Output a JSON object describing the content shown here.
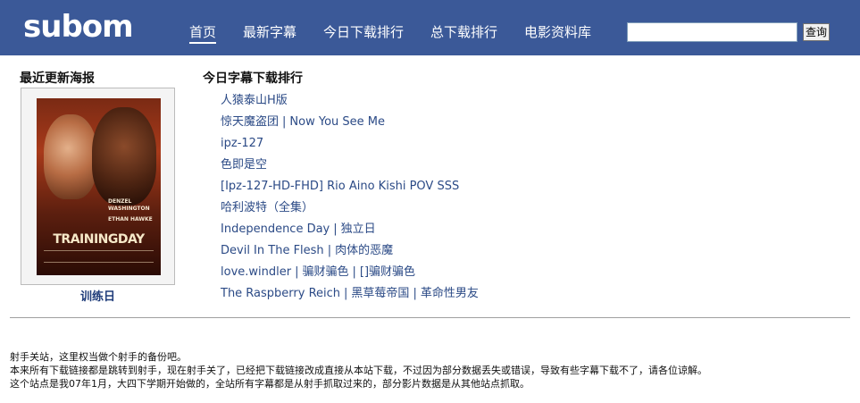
{
  "header": {
    "logo_text": "subom",
    "nav": [
      {
        "label": "首页",
        "active": true
      },
      {
        "label": "最新字幕",
        "active": false
      },
      {
        "label": "今日下载排行",
        "active": false
      },
      {
        "label": "总下载排行",
        "active": false
      },
      {
        "label": "电影资料库",
        "active": false
      }
    ],
    "search_value": "",
    "search_button": "查询",
    "bg_color": "#3b5998"
  },
  "poster_section": {
    "title": "最近更新海报",
    "poster_image_text": {
      "credit_line1": "DENZEL WASHINGTON",
      "credit_line2": "ETHAN HAWKE",
      "title": "TRAININGDAY"
    },
    "caption": "训练日"
  },
  "ranking": {
    "title": "今日字幕下载排行",
    "items": [
      {
        "parts": [
          "人猿泰山H版"
        ]
      },
      {
        "parts": [
          "惊天魔盗团",
          "Now You See Me"
        ]
      },
      {
        "parts": [
          "ipz-127"
        ]
      },
      {
        "parts": [
          "色即是空"
        ]
      },
      {
        "parts": [
          "[Ipz-127-HD-FHD] Rio Aino Kishi POV SSS"
        ]
      },
      {
        "parts": [
          "哈利波特（全集）"
        ]
      },
      {
        "parts": [
          "Independence Day",
          "独立日"
        ]
      },
      {
        "parts": [
          "Devil In The Flesh",
          "肉体的恶魔"
        ]
      },
      {
        "parts": [
          "love.windler",
          "骗财骗色",
          "[]骗财骗色"
        ]
      },
      {
        "parts": [
          "The Raspberry Reich",
          "黑草莓帝国",
          "革命性男友"
        ]
      }
    ],
    "separator": "|"
  },
  "footer": {
    "lines": [
      "射手关站，这里权当做个射手的备份吧。",
      "本来所有下载链接都是跳转到射手，现在射手关了，已经把下载链接改成直接从本站下载，不过因为部分数据丢失或错误，导致有些字幕下载不了，请各位谅解。",
      "这个站点是我07年1月，大四下学期开始做的，全站所有字幕都是从射手抓取过来的，部分影片数据是从其他站点抓取。"
    ]
  }
}
